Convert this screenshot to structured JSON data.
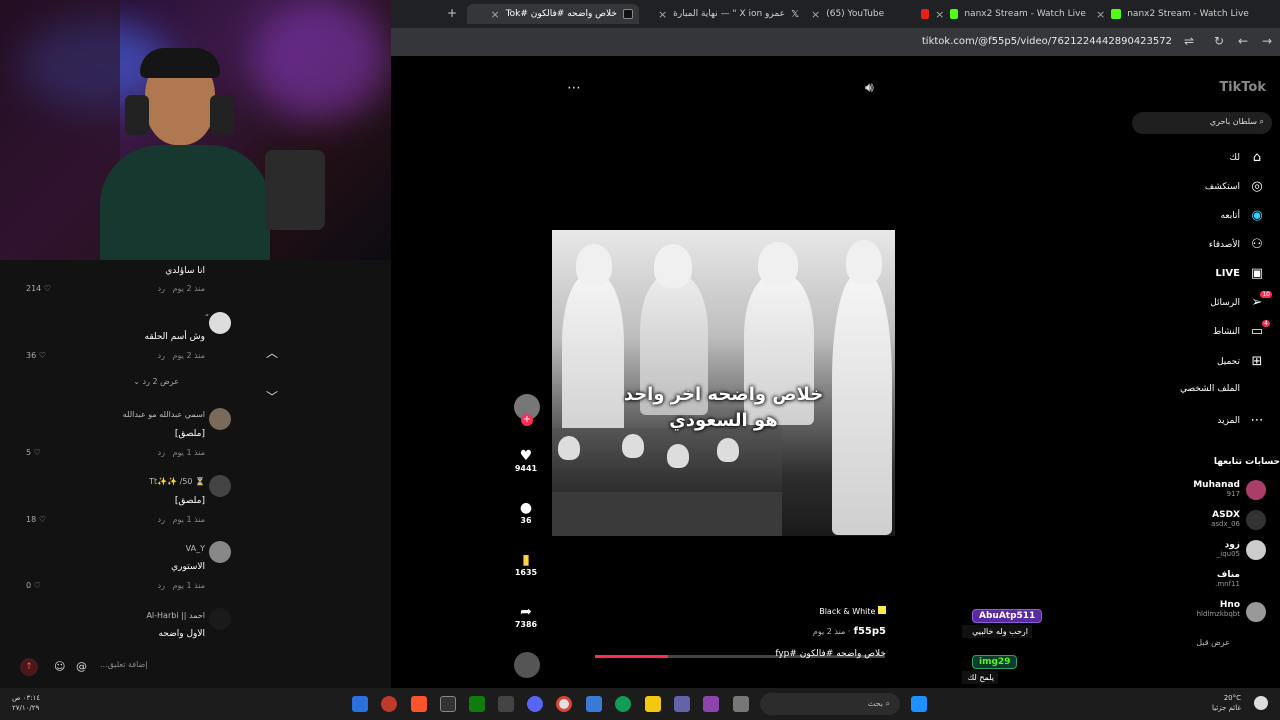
{
  "browser": {
    "tabs": [
      {
        "label": "خلاص واضحه #فالكون #Tok",
        "active": true
      },
      {
        "label": "عمرو X ion \" — نهاية المبارة"
      },
      {
        "label": "(65) YouTube"
      },
      {
        "label": "nanx2 Stream - Watch Live"
      },
      {
        "label": "nanx2 Stream - Watch Live"
      }
    ],
    "new_tab": "+",
    "url": "tiktok.com/@f55p5/video/7621224442890423572"
  },
  "comments": {
    "items": [
      {
        "text": "انا ساؤلدي",
        "meta": "منذ 2 يوم",
        "reply": "رد",
        "likes": "214"
      },
      {
        "user": "ّ",
        "text": "وش أسم الحلقه",
        "meta": "منذ 2 يوم",
        "reply": "رد",
        "likes": "36"
      },
      {
        "view_replies": "عرض 2 رد"
      },
      {
        "user": "اسمي عبدالله مو عبدالله",
        "text": "[ملصق]",
        "meta": "منذ 1 يوم",
        "reply": "رد",
        "likes": "5"
      },
      {
        "user": "⏳ Tt✨✨ /50",
        "text": "[ملصق]",
        "meta": "منذ 1 يوم",
        "reply": "رد",
        "likes": "18"
      },
      {
        "user": "VA_Y",
        "text": "الاستوري",
        "meta": "منذ 1 يوم",
        "reply": "رد",
        "likes": "0"
      },
      {
        "user": "احمد || Al-Harbi",
        "text": "الاول واضحه",
        "meta": "",
        "reply": "",
        "likes": ""
      }
    ],
    "placeholder": "إضافة تعليق..."
  },
  "video": {
    "caption_line1": "خلاص واضحه اخر واحد",
    "caption_line2": "هو السعودي",
    "username": "f55p5",
    "time": "منذ 2 يوم",
    "description": "خلاص واضحه #فالكون #fyp",
    "music": "Black & White",
    "progress": 0.25
  },
  "actions": {
    "likes": "9441",
    "comments": "36",
    "saves": "1635",
    "shares": "7386"
  },
  "sidebar": {
    "logo": "TikTok",
    "search": "سلطان باحري",
    "nav": [
      {
        "label": "لك",
        "icon": "home-icon"
      },
      {
        "label": "استكشف",
        "icon": "compass-icon"
      },
      {
        "label": "أتابعه",
        "icon": "following-icon"
      },
      {
        "label": "الأصدقاء",
        "icon": "friends-icon"
      },
      {
        "label": "LIVE",
        "icon": "live-icon"
      },
      {
        "label": "الرسائل",
        "icon": "messages-icon",
        "badge": "10"
      },
      {
        "label": "النشاط",
        "icon": "activity-icon",
        "badge": "4"
      },
      {
        "label": "تحميل",
        "icon": "upload-icon"
      },
      {
        "label": "الملف الشخصي",
        "icon": "profile-icon"
      },
      {
        "label": "المزيد",
        "icon": "more-icon"
      }
    ],
    "following_title": "حسابات تتابعها",
    "following": [
      {
        "name": "Muhanad",
        "handle": "917"
      },
      {
        "name": "ASDX",
        "handle": "asdx_06"
      },
      {
        "name": "زود",
        "handle": "iqu05_"
      },
      {
        "name": "مناف",
        "handle": "mnf11."
      },
      {
        "name": "Hno",
        "handle": "hldlmzkbqbt"
      }
    ],
    "show_more": "عرض قبل"
  },
  "chat": [
    {
      "user": "AbuAtp511",
      "text": "ارحب وله خالبيي"
    },
    {
      "user": "img29",
      "text": "يلمح لك"
    }
  ],
  "taskbar": {
    "time": "٠٣:١٤ ص",
    "date": "٢٧/١٠/٢٩",
    "weather_temp": "20°C",
    "weather_desc": "غائم جزئيا",
    "search": "بحث"
  }
}
